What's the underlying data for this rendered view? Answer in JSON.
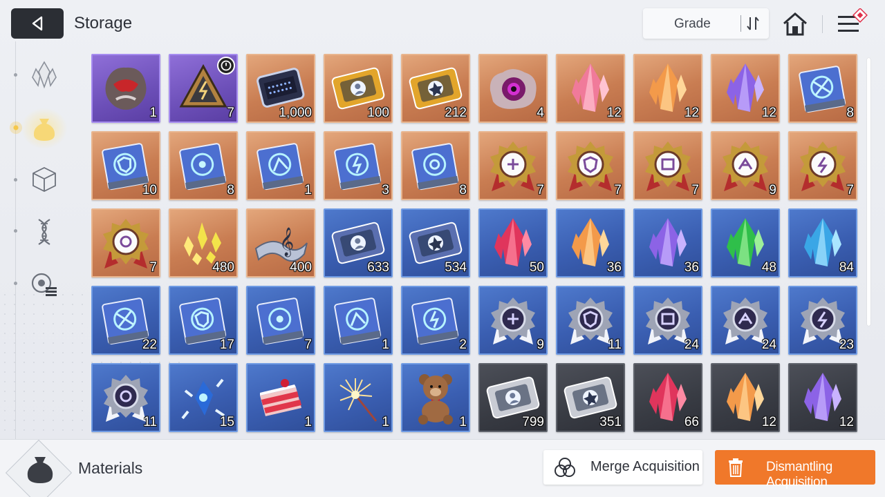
{
  "header": {
    "title": "Storage",
    "sort_label": "Grade"
  },
  "sidebar": {
    "items": [
      {
        "name": "crystal-category",
        "icon": "crystal-icon",
        "active": false
      },
      {
        "name": "materials-category",
        "icon": "bag-icon",
        "active": true
      },
      {
        "name": "box-category",
        "icon": "cube-icon",
        "active": false
      },
      {
        "name": "gene-category",
        "icon": "dna-icon",
        "active": false
      },
      {
        "name": "list-category",
        "icon": "list-gear-icon",
        "active": false
      }
    ]
  },
  "items": [
    {
      "grade": "purple",
      "art": "fossil",
      "count": "1"
    },
    {
      "grade": "purple",
      "art": "pyramid",
      "count": "7",
      "timer": true
    },
    {
      "grade": "orange",
      "art": "chip",
      "count": "1,000"
    },
    {
      "grade": "orange",
      "art": "card-gold-person",
      "count": "100"
    },
    {
      "grade": "orange",
      "art": "card-gold-star",
      "count": "212"
    },
    {
      "grade": "orange",
      "art": "eye-rock",
      "count": "4"
    },
    {
      "grade": "orange",
      "art": "crystal-pink",
      "count": "12"
    },
    {
      "grade": "orange",
      "art": "crystal-orange",
      "count": "12"
    },
    {
      "grade": "orange",
      "art": "crystal-purple",
      "count": "12"
    },
    {
      "grade": "orange",
      "art": "book-swords",
      "count": "8"
    },
    {
      "grade": "orange",
      "art": "book-shield",
      "count": "10"
    },
    {
      "grade": "orange",
      "art": "book-eye",
      "count": "8"
    },
    {
      "grade": "orange",
      "art": "book-wing",
      "count": "1"
    },
    {
      "grade": "orange",
      "art": "book-bolt",
      "count": "3"
    },
    {
      "grade": "orange",
      "art": "book-gear",
      "count": "8"
    },
    {
      "grade": "orange",
      "art": "medal-sword",
      "count": "7"
    },
    {
      "grade": "orange",
      "art": "medal-shield",
      "count": "7"
    },
    {
      "grade": "orange",
      "art": "medal-target",
      "count": "7"
    },
    {
      "grade": "orange",
      "art": "medal-wing",
      "count": "9"
    },
    {
      "grade": "orange",
      "art": "medal-bolt",
      "count": "7"
    },
    {
      "grade": "orange",
      "art": "medal-gear",
      "count": "7"
    },
    {
      "grade": "orange",
      "art": "shards-yellow",
      "count": "480"
    },
    {
      "grade": "orange",
      "art": "music-ribbon",
      "count": "400"
    },
    {
      "grade": "blue",
      "art": "card-blue-person",
      "count": "633"
    },
    {
      "grade": "blue",
      "art": "card-blue-star",
      "count": "534"
    },
    {
      "grade": "blue",
      "art": "crystal-red",
      "count": "50"
    },
    {
      "grade": "blue",
      "art": "crystal-orange",
      "count": "36"
    },
    {
      "grade": "blue",
      "art": "crystal-purple",
      "count": "36"
    },
    {
      "grade": "blue",
      "art": "crystal-green",
      "count": "48"
    },
    {
      "grade": "blue",
      "art": "crystal-cyan",
      "count": "84"
    },
    {
      "grade": "blue",
      "art": "book-swords",
      "count": "22"
    },
    {
      "grade": "blue",
      "art": "book-shield",
      "count": "17"
    },
    {
      "grade": "blue",
      "art": "book-eye",
      "count": "7"
    },
    {
      "grade": "blue",
      "art": "book-wing",
      "count": "1"
    },
    {
      "grade": "blue",
      "art": "book-bolt",
      "count": "2"
    },
    {
      "grade": "blue",
      "art": "badge-sword",
      "count": "9"
    },
    {
      "grade": "blue",
      "art": "badge-shield",
      "count": "11"
    },
    {
      "grade": "blue",
      "art": "badge-target",
      "count": "24"
    },
    {
      "grade": "blue",
      "art": "badge-wing",
      "count": "24"
    },
    {
      "grade": "blue",
      "art": "badge-bolt",
      "count": "23"
    },
    {
      "grade": "blue",
      "art": "badge-gear",
      "count": "11"
    },
    {
      "grade": "blue",
      "art": "ice-crystal",
      "count": "15"
    },
    {
      "grade": "blue",
      "art": "cake",
      "count": "1"
    },
    {
      "grade": "blue",
      "art": "sparkler",
      "count": "1"
    },
    {
      "grade": "blue",
      "art": "teddy-bear",
      "count": "1"
    },
    {
      "grade": "gray",
      "art": "card-silver-person",
      "count": "799"
    },
    {
      "grade": "gray",
      "art": "card-silver-star",
      "count": "351"
    },
    {
      "grade": "gray",
      "art": "crystal-red",
      "count": "66"
    },
    {
      "grade": "gray",
      "art": "crystal-orange",
      "count": "12"
    },
    {
      "grade": "gray",
      "art": "crystal-purple",
      "count": "12"
    }
  ],
  "footer": {
    "category_label": "Materials",
    "merge_label": "Merge Acquisition",
    "dismantle_label": "Dismantling Acquisition"
  },
  "colors": {
    "accent": "#f0782a",
    "grade_purple": "#6c4fb8",
    "grade_orange": "#c97d52",
    "grade_blue": "#3a5eb1",
    "grade_gray": "#383b43"
  }
}
